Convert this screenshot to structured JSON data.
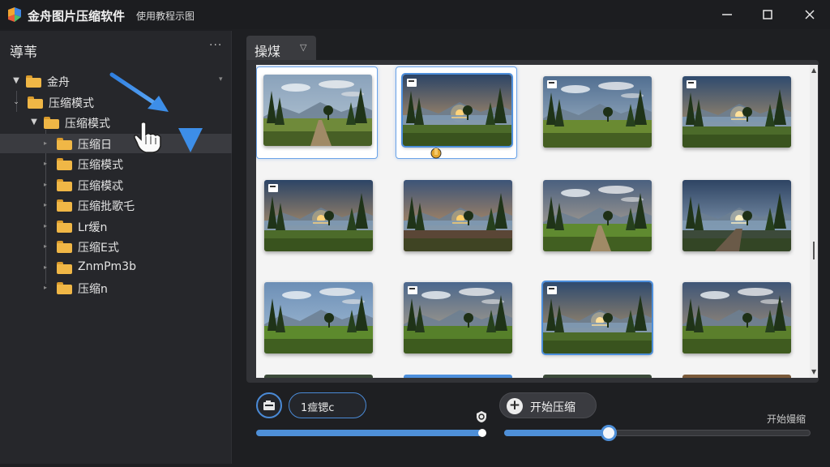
{
  "window": {
    "title": "金舟图片压缩软件",
    "subtitle": "使用教程示图",
    "minimize_icon": "minimize-icon",
    "maximize_icon": "maximize-icon",
    "close_icon": "close-icon"
  },
  "sidebar": {
    "title": "導苇",
    "more_icon": "more-icon",
    "items": [
      {
        "label": "金舟",
        "level": 0,
        "expanded": true
      },
      {
        "label": "压缩模式",
        "level": 1,
        "expanded": true
      },
      {
        "label": "压缩模式",
        "level": 2,
        "expanded": true
      },
      {
        "label": "压缩日",
        "level": 3,
        "selected": true
      },
      {
        "label": "压缩模式",
        "level": 3
      },
      {
        "label": "压缩模忒",
        "level": 3
      },
      {
        "label": "压缩批歌乇",
        "level": 3
      },
      {
        "label": "Lr缓n",
        "level": 3
      },
      {
        "label": "压缩E式",
        "level": 3
      },
      {
        "label": "ZnmPm3b",
        "level": 3
      },
      {
        "label": "压缩n",
        "level": 3
      }
    ]
  },
  "main": {
    "tab_label": "操煤",
    "tab_icon": "chevron-down-icon",
    "thumbnails": [
      {
        "scene": "forest-path",
        "selected": true,
        "badge": false
      },
      {
        "scene": "lake-sunset",
        "selected": true,
        "badge": true,
        "blue": true
      },
      {
        "scene": "mountain-meadow",
        "badge": true
      },
      {
        "scene": "lake-tree",
        "badge": true
      },
      {
        "scene": "lake-sunset",
        "badge": true
      },
      {
        "scene": "shore-sunset"
      },
      {
        "scene": "meadow-clouds"
      },
      {
        "scene": "lake-dock"
      },
      {
        "scene": "mountain-meadow-2"
      },
      {
        "scene": "hill-clouds",
        "badge": true
      },
      {
        "scene": "lake-tree",
        "badge": true,
        "blue": true
      },
      {
        "scene": "hill-clouds-2"
      }
    ]
  },
  "controls": {
    "camera_icon": "camera-icon",
    "quality_label": "1痖锶c",
    "quality_caret": "⌄",
    "start_label": "开始压缩",
    "start_icon": "plus-icon",
    "right_label": "开始嫚缩",
    "slider1_value": 1.0,
    "slider2_value": 0.34
  },
  "colors": {
    "accent": "#4e8fd8",
    "folder": "#f0b746",
    "background": "#1e1f22"
  }
}
